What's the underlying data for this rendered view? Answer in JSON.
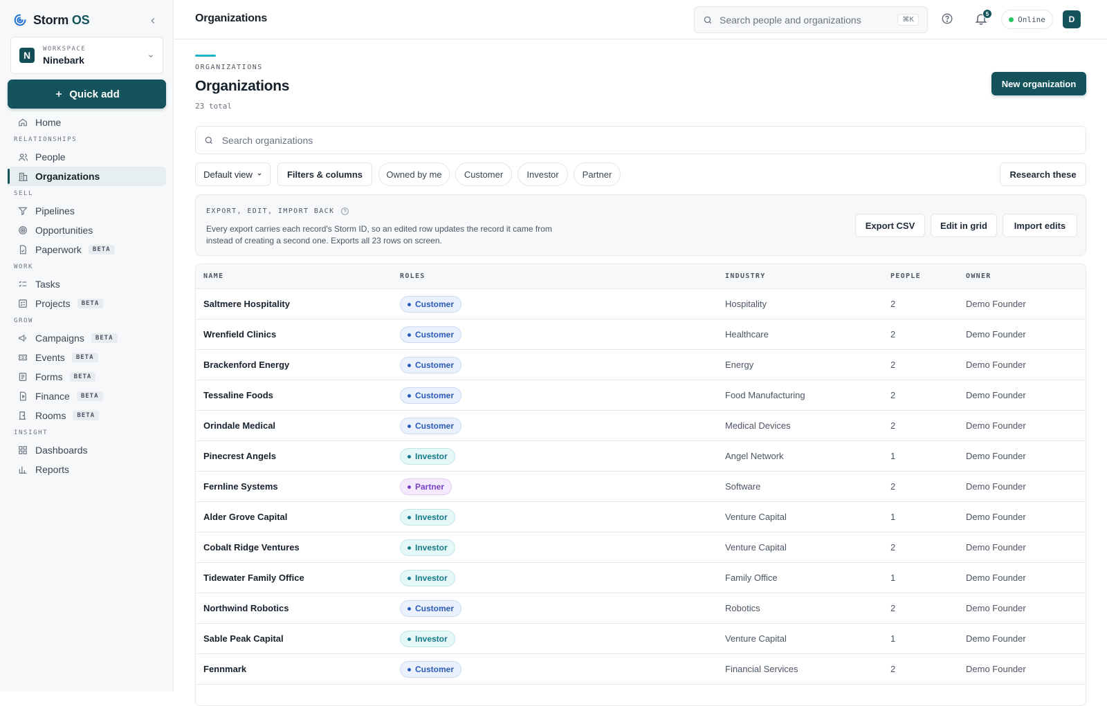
{
  "app": {
    "brand_main": "Storm",
    "brand_accent": "OS"
  },
  "workspace": {
    "label": "WORKSPACE",
    "name": "Ninebark",
    "initial": "N"
  },
  "quick_add": "Quick add",
  "nav": {
    "home": "Home",
    "sec_relationships": "RELATIONSHIPS",
    "people": "People",
    "organizations": "Organizations",
    "sec_sell": "SELL",
    "pipelines": "Pipelines",
    "opportunities": "Opportunities",
    "paperwork": "Paperwork",
    "sec_work": "WORK",
    "tasks": "Tasks",
    "projects": "Projects",
    "sec_grow": "GROW",
    "campaigns": "Campaigns",
    "events": "Events",
    "forms": "Forms",
    "finance": "Finance",
    "rooms": "Rooms",
    "sec_insight": "INSIGHT",
    "dashboards": "Dashboards",
    "reports": "Reports",
    "beta": "BETA"
  },
  "topbar": {
    "title": "Organizations",
    "search_placeholder": "Search people and organizations",
    "shortcut": "⌘K",
    "notifications": "5",
    "status": "Online",
    "user_initial": "D"
  },
  "page": {
    "eyebrow": "ORGANIZATIONS",
    "title": "Organizations",
    "count": "23 total",
    "new_button": "New organization",
    "search_placeholder": "Search organizations"
  },
  "filters": {
    "view": "Default view",
    "filters_columns": "Filters & columns",
    "chips": [
      "Owned by me",
      "Customer",
      "Investor",
      "Partner"
    ],
    "research": "Research these"
  },
  "export": {
    "title": "EXPORT, EDIT, IMPORT BACK",
    "description": "Every export carries each record's Storm ID, so an edited row updates the record it came from instead of creating a second one. Exports all 23 rows on screen.",
    "export_csv": "Export CSV",
    "edit_grid": "Edit in grid",
    "import_edits": "Import edits"
  },
  "table": {
    "headers": [
      "NAME",
      "ROLES",
      "INDUSTRY",
      "PEOPLE",
      "OWNER"
    ],
    "rows": [
      {
        "name": "Saltmere Hospitality",
        "role": "Customer",
        "industry": "Hospitality",
        "people": "2",
        "owner": "Demo Founder"
      },
      {
        "name": "Wrenfield Clinics",
        "role": "Customer",
        "industry": "Healthcare",
        "people": "2",
        "owner": "Demo Founder"
      },
      {
        "name": "Brackenford Energy",
        "role": "Customer",
        "industry": "Energy",
        "people": "2",
        "owner": "Demo Founder"
      },
      {
        "name": "Tessaline Foods",
        "role": "Customer",
        "industry": "Food Manufacturing",
        "people": "2",
        "owner": "Demo Founder"
      },
      {
        "name": "Orindale Medical",
        "role": "Customer",
        "industry": "Medical Devices",
        "people": "2",
        "owner": "Demo Founder"
      },
      {
        "name": "Pinecrest Angels",
        "role": "Investor",
        "industry": "Angel Network",
        "people": "1",
        "owner": "Demo Founder"
      },
      {
        "name": "Fernline Systems",
        "role": "Partner",
        "industry": "Software",
        "people": "2",
        "owner": "Demo Founder"
      },
      {
        "name": "Alder Grove Capital",
        "role": "Investor",
        "industry": "Venture Capital",
        "people": "1",
        "owner": "Demo Founder"
      },
      {
        "name": "Cobalt Ridge Ventures",
        "role": "Investor",
        "industry": "Venture Capital",
        "people": "2",
        "owner": "Demo Founder"
      },
      {
        "name": "Tidewater Family Office",
        "role": "Investor",
        "industry": "Family Office",
        "people": "1",
        "owner": "Demo Founder"
      },
      {
        "name": "Northwind Robotics",
        "role": "Customer",
        "industry": "Robotics",
        "people": "2",
        "owner": "Demo Founder"
      },
      {
        "name": "Sable Peak Capital",
        "role": "Investor",
        "industry": "Venture Capital",
        "people": "1",
        "owner": "Demo Founder"
      },
      {
        "name": "Fennmark",
        "role": "Customer",
        "industry": "Financial Services",
        "people": "2",
        "owner": "Demo Founder"
      }
    ]
  },
  "colors": {
    "accent": "#14535c",
    "accent_line": "#1cb5c7",
    "customer_bg": "#eaf1fd",
    "customer_fg": "#2a5bb8",
    "customer_border": "#c9daf7",
    "investor_bg": "#e6f7f8",
    "investor_fg": "#137a86",
    "investor_border": "#bfe6ea",
    "partner_bg": "#f3ebfd",
    "partner_fg": "#7a3fc4",
    "partner_border": "#e0cdf7"
  }
}
